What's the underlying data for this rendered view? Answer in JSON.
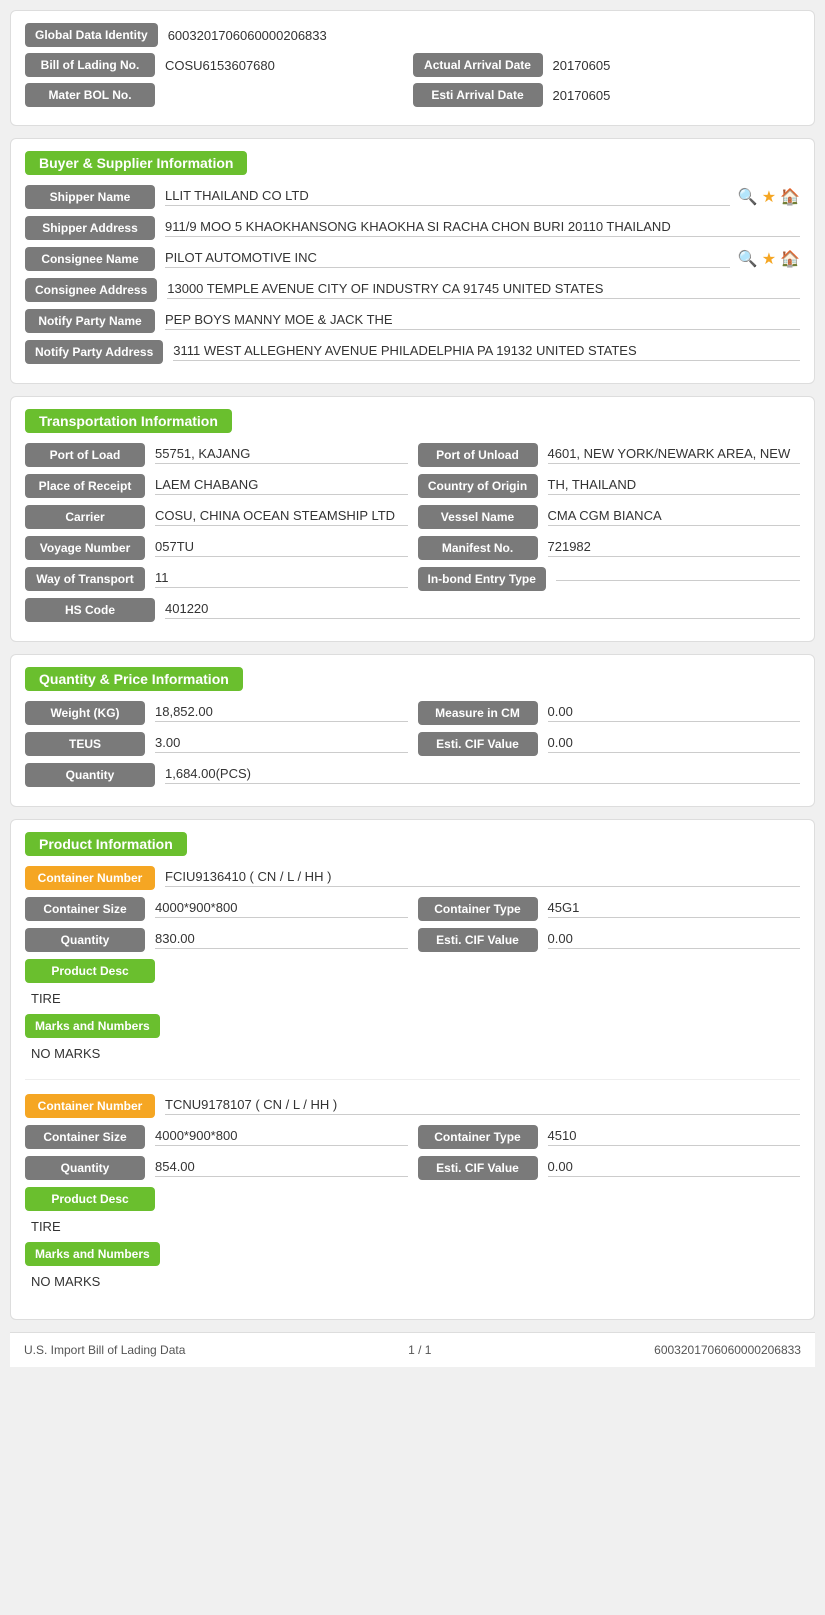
{
  "header": {
    "global_data_identity_label": "Global Data Identity",
    "global_data_identity_value": "6003201706060000206833",
    "bill_of_lading_label": "Bill of Lading No.",
    "bill_of_lading_value": "COSU6153607680",
    "actual_arrival_date_label": "Actual Arrival Date",
    "actual_arrival_date_value": "20170605",
    "mater_bol_label": "Mater BOL No.",
    "mater_bol_value": "",
    "esti_arrival_date_label": "Esti Arrival Date",
    "esti_arrival_date_value": "20170605"
  },
  "buyer_supplier": {
    "title": "Buyer & Supplier Information",
    "shipper_name_label": "Shipper Name",
    "shipper_name_value": "LLIT THAILAND CO LTD",
    "shipper_address_label": "Shipper Address",
    "shipper_address_value": "911/9 MOO 5 KHAOKHANSONG KHAOKHA SI RACHA CHON BURI 20110 THAILAND",
    "consignee_name_label": "Consignee Name",
    "consignee_name_value": "PILOT AUTOMOTIVE INC",
    "consignee_address_label": "Consignee Address",
    "consignee_address_value": "13000 TEMPLE AVENUE CITY OF INDUSTRY CA 91745 UNITED STATES",
    "notify_party_name_label": "Notify Party Name",
    "notify_party_name_value": "PEP BOYS MANNY MOE & JACK THE",
    "notify_party_address_label": "Notify Party Address",
    "notify_party_address_value": "3111 WEST ALLEGHENY AVENUE PHILADELPHIA PA 19132 UNITED STATES"
  },
  "transportation": {
    "title": "Transportation Information",
    "port_of_load_label": "Port of Load",
    "port_of_load_value": "55751, KAJANG",
    "port_of_unload_label": "Port of Unload",
    "port_of_unload_value": "4601, NEW YORK/NEWARK AREA, NEW",
    "place_of_receipt_label": "Place of Receipt",
    "place_of_receipt_value": "LAEM CHABANG",
    "country_of_origin_label": "Country of Origin",
    "country_of_origin_value": "TH, THAILAND",
    "carrier_label": "Carrier",
    "carrier_value": "COSU, CHINA OCEAN STEAMSHIP LTD",
    "vessel_name_label": "Vessel Name",
    "vessel_name_value": "CMA CGM BIANCA",
    "voyage_number_label": "Voyage Number",
    "voyage_number_value": "057TU",
    "manifest_no_label": "Manifest No.",
    "manifest_no_value": "721982",
    "way_of_transport_label": "Way of Transport",
    "way_of_transport_value": "11",
    "in_bond_entry_type_label": "In-bond Entry Type",
    "in_bond_entry_type_value": "",
    "hs_code_label": "HS Code",
    "hs_code_value": "401220"
  },
  "quantity_price": {
    "title": "Quantity & Price Information",
    "weight_kg_label": "Weight (KG)",
    "weight_kg_value": "18,852.00",
    "measure_in_cm_label": "Measure in CM",
    "measure_in_cm_value": "0.00",
    "teus_label": "TEUS",
    "teus_value": "3.00",
    "esti_cif_value_label": "Esti. CIF Value",
    "esti_cif_value_value": "0.00",
    "quantity_label": "Quantity",
    "quantity_value": "1,684.00(PCS)"
  },
  "product_information": {
    "title": "Product Information",
    "containers": [
      {
        "container_number_label": "Container Number",
        "container_number_value": "FCIU9136410 ( CN / L / HH )",
        "container_size_label": "Container Size",
        "container_size_value": "4000*900*800",
        "container_type_label": "Container Type",
        "container_type_value": "45G1",
        "quantity_label": "Quantity",
        "quantity_value": "830.00",
        "esti_cif_value_label": "Esti. CIF Value",
        "esti_cif_value_value": "0.00",
        "product_desc_label": "Product Desc",
        "product_desc_value": "TIRE",
        "marks_numbers_label": "Marks and Numbers",
        "marks_numbers_value": "NO MARKS"
      },
      {
        "container_number_label": "Container Number",
        "container_number_value": "TCNU9178107 ( CN / L / HH )",
        "container_size_label": "Container Size",
        "container_size_value": "4000*900*800",
        "container_type_label": "Container Type",
        "container_type_value": "4510",
        "quantity_label": "Quantity",
        "quantity_value": "854.00",
        "esti_cif_value_label": "Esti. CIF Value",
        "esti_cif_value_value": "0.00",
        "product_desc_label": "Product Desc",
        "product_desc_value": "TIRE",
        "marks_numbers_label": "Marks and Numbers",
        "marks_numbers_value": "NO MARKS"
      }
    ]
  },
  "footer": {
    "left_label": "U.S. Import Bill of Lading Data",
    "page_info": "1 / 1",
    "right_id": "6003201706060000206833"
  }
}
